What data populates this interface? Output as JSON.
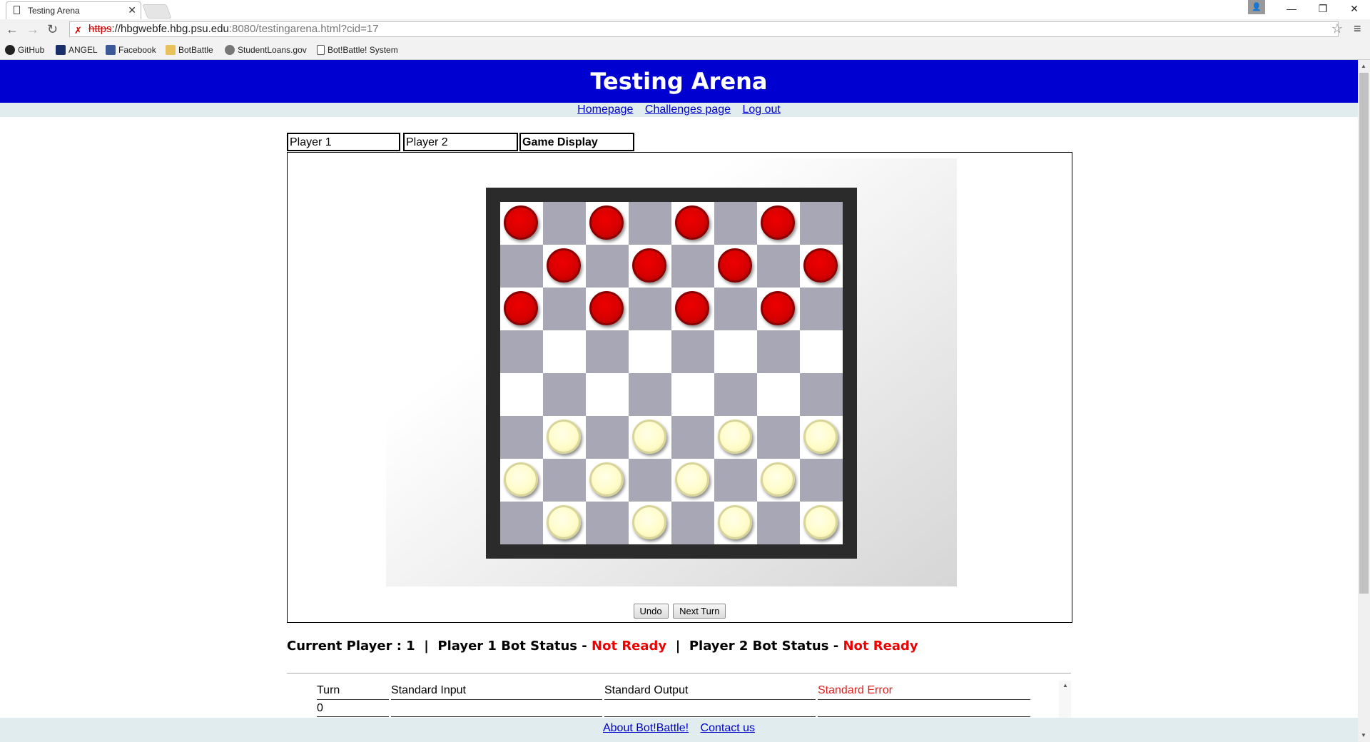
{
  "browser": {
    "tab_title": "Testing Arena",
    "url_scheme": "https",
    "url_host": "://hbgwebfe.hbg.psu.edu",
    "url_rest": ":8080/testingarena.html?cid=17",
    "bookmarks": [
      {
        "label": "GitHub",
        "icon": "github-icon",
        "color": "#222222"
      },
      {
        "label": "ANGEL",
        "icon": "shield-icon",
        "color": "#1a2e6b"
      },
      {
        "label": "Facebook",
        "icon": "facebook-icon",
        "color": "#3b5998"
      },
      {
        "label": "BotBattle",
        "icon": "folder-icon",
        "color": "#e8c15a"
      },
      {
        "label": "StudentLoans.gov",
        "icon": "globe-icon",
        "color": "#777777"
      },
      {
        "label": "Bot!Battle! System",
        "icon": "page-icon",
        "color": "#ffffff"
      }
    ]
  },
  "page": {
    "title": "Testing Arena",
    "nav": {
      "home": "Homepage",
      "challenges": "Challenges page",
      "logout": "Log out"
    },
    "tabs": {
      "player1": "Player 1",
      "player2": "Player 2",
      "game_display": "Game Display"
    },
    "board": {
      "size": 8,
      "light_color": "#ffffff",
      "dark_color": "#a7a7b6",
      "frame_color": "#2b2b2b",
      "red_pieces": [
        [
          0,
          0
        ],
        [
          0,
          2
        ],
        [
          0,
          4
        ],
        [
          0,
          6
        ],
        [
          1,
          1
        ],
        [
          1,
          3
        ],
        [
          1,
          5
        ],
        [
          1,
          7
        ],
        [
          2,
          0
        ],
        [
          2,
          2
        ],
        [
          2,
          4
        ],
        [
          2,
          6
        ]
      ],
      "white_pieces": [
        [
          5,
          1
        ],
        [
          5,
          3
        ],
        [
          5,
          5
        ],
        [
          5,
          7
        ],
        [
          6,
          0
        ],
        [
          6,
          2
        ],
        [
          6,
          4
        ],
        [
          6,
          6
        ],
        [
          7,
          1
        ],
        [
          7,
          3
        ],
        [
          7,
          5
        ],
        [
          7,
          7
        ]
      ]
    },
    "buttons": {
      "undo": "Undo",
      "next_turn": "Next Turn"
    },
    "status": {
      "current_player_label": "Current Player : 1",
      "sep": "|",
      "p1_label": "Player 1 Bot Status - ",
      "p1_value": "Not Ready",
      "p2_label": "Player 2 Bot Status - ",
      "p2_value": "Not Ready"
    },
    "log": {
      "headers": {
        "turn": "Turn",
        "stdin": "Standard Input",
        "stdout": "Standard Output",
        "stderr": "Standard Error"
      },
      "rows": [
        {
          "turn": "0"
        }
      ]
    },
    "footer": {
      "about": "About Bot!Battle!",
      "contact": "Contact us"
    }
  }
}
